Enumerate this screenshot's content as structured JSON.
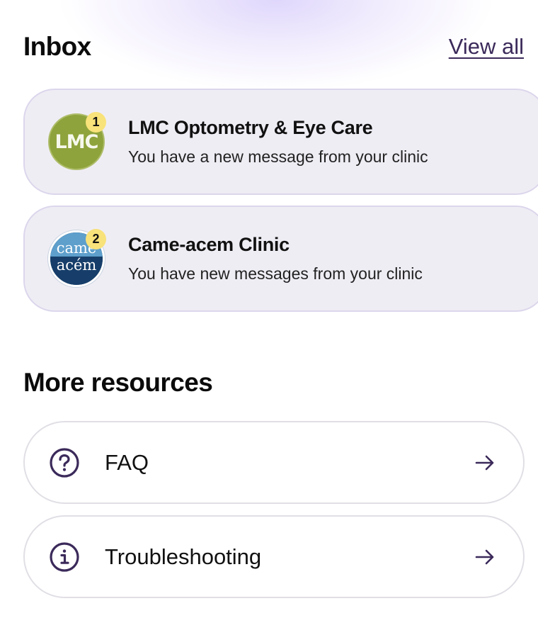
{
  "inbox": {
    "title": "Inbox",
    "view_all_label": "View all",
    "items": [
      {
        "clinic_name": "LMC Optometry & Eye Care",
        "message": "You have a new message from your clinic",
        "unread_count": "1",
        "avatar_text": "LMC"
      },
      {
        "clinic_name": "Came-acem Clinic",
        "message": "You have new messages from your clinic",
        "unread_count": "2",
        "avatar_text_top": "came",
        "avatar_text_bottom": "acém"
      }
    ]
  },
  "resources": {
    "title": "More resources",
    "items": [
      {
        "label": "FAQ",
        "icon": "question-circle-icon"
      },
      {
        "label": "Troubleshooting",
        "icon": "info-circle-icon"
      }
    ]
  },
  "colors": {
    "accent": "#3b2a5a",
    "card_background": "#efedf4",
    "card_border": "#dcd6ec",
    "badge": "#f8e27a",
    "lmc_avatar": "#8ea33b",
    "came_avatar": "#18416e"
  }
}
